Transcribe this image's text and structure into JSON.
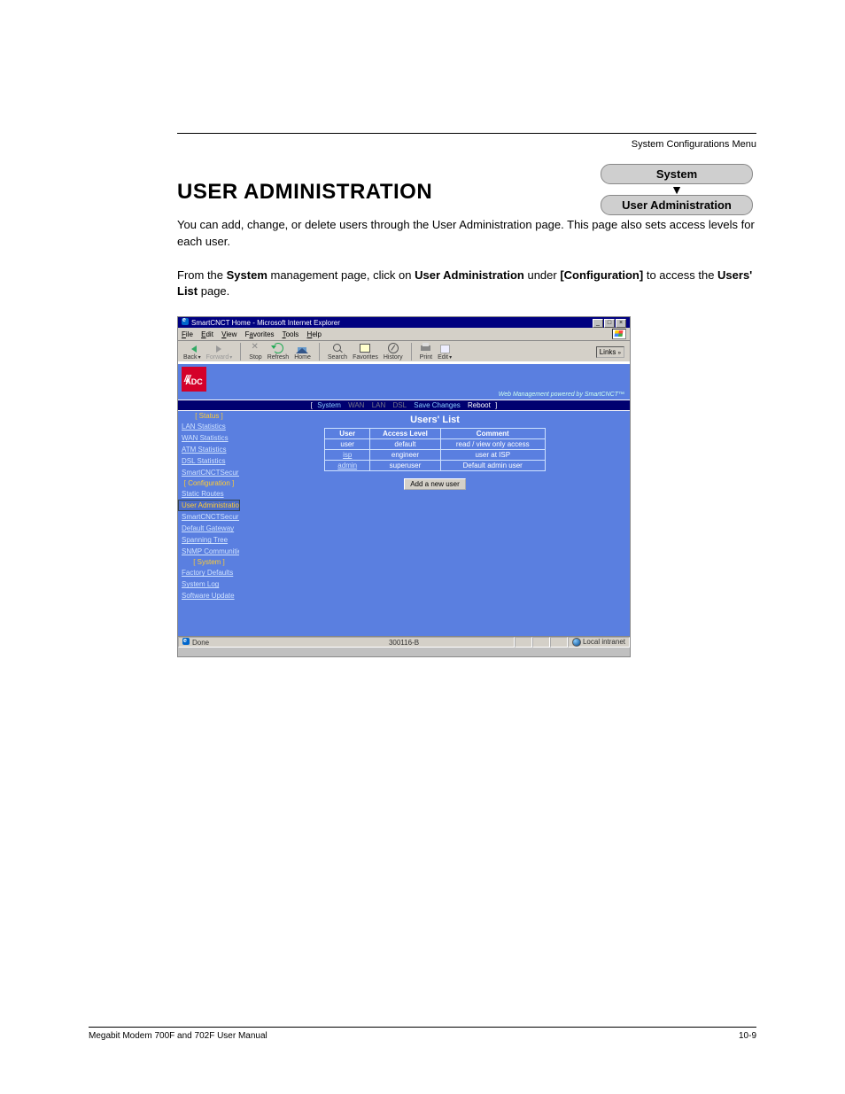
{
  "running_head": "System Configurations Menu",
  "section_title": "USER ADMINISTRATION",
  "crumbs": {
    "top": "System",
    "bottom": "User Administration"
  },
  "intro": {
    "line1_pre": "You can add, change, or delete users through the User Administration page. This page also sets access levels for each user.",
    "line2_a": "From the ",
    "line2_b": "System",
    "line2_c": " management page, click on ",
    "line2_d": "User Administration",
    "line2_e": " under ",
    "line2_f": "[Configuration]",
    "line2_g": " to access the ",
    "line2_h": "Users' List",
    "line2_i": " page."
  },
  "browser": {
    "title": "SmartCNCT Home - Microsoft Internet Explorer",
    "menus": [
      "File",
      "Edit",
      "View",
      "Favorites",
      "Tools",
      "Help"
    ],
    "tb": {
      "back": "Back",
      "forward": "Forward",
      "stop": "Stop",
      "refresh": "Refresh",
      "home": "Home",
      "search": "Search",
      "favorites": "Favorites",
      "history": "History",
      "print": "Print",
      "edit": "Edit"
    },
    "links_label": "Links",
    "status_done": "Done",
    "status_code": "300116-B",
    "status_zone": "Local intranet"
  },
  "app": {
    "logo_text": "ADC",
    "tagline": "Web Management powered by SmartCNCT™",
    "topnav": [
      "System",
      "WAN",
      "LAN",
      "DSL",
      "Save Changes",
      "Reboot"
    ],
    "page_title": "Users' List",
    "sidebar": {
      "g1": "[ Status ]",
      "g1_items": [
        "LAN Statistics",
        "WAN Statistics",
        "ATM Statistics",
        "DSL Statistics",
        "SmartCNCTSecurity"
      ],
      "g2": "[ Configuration ]",
      "g2_items": [
        "Static Routes",
        "User Administration",
        "SmartCNCTSecurity",
        "Default Gateway",
        "Spanning Tree",
        "SNMP Communities"
      ],
      "g3": "[ System ]",
      "g3_items": [
        "Factory Defaults",
        "System Log",
        "Software Update"
      ]
    },
    "table": {
      "headers": [
        "User",
        "Access Level",
        "Comment"
      ],
      "rows": [
        {
          "user": "user",
          "level": "default",
          "comment": "read / view only access",
          "link": false
        },
        {
          "user": "isp",
          "level": "engineer",
          "comment": "user at ISP",
          "link": true
        },
        {
          "user": "admin",
          "level": "superuser",
          "comment": "Default admin user",
          "link": true
        }
      ]
    },
    "add_button": "Add a new user"
  },
  "footer": {
    "left": "Megabit Modem 700F and 702F User Manual",
    "right": "10-9"
  }
}
